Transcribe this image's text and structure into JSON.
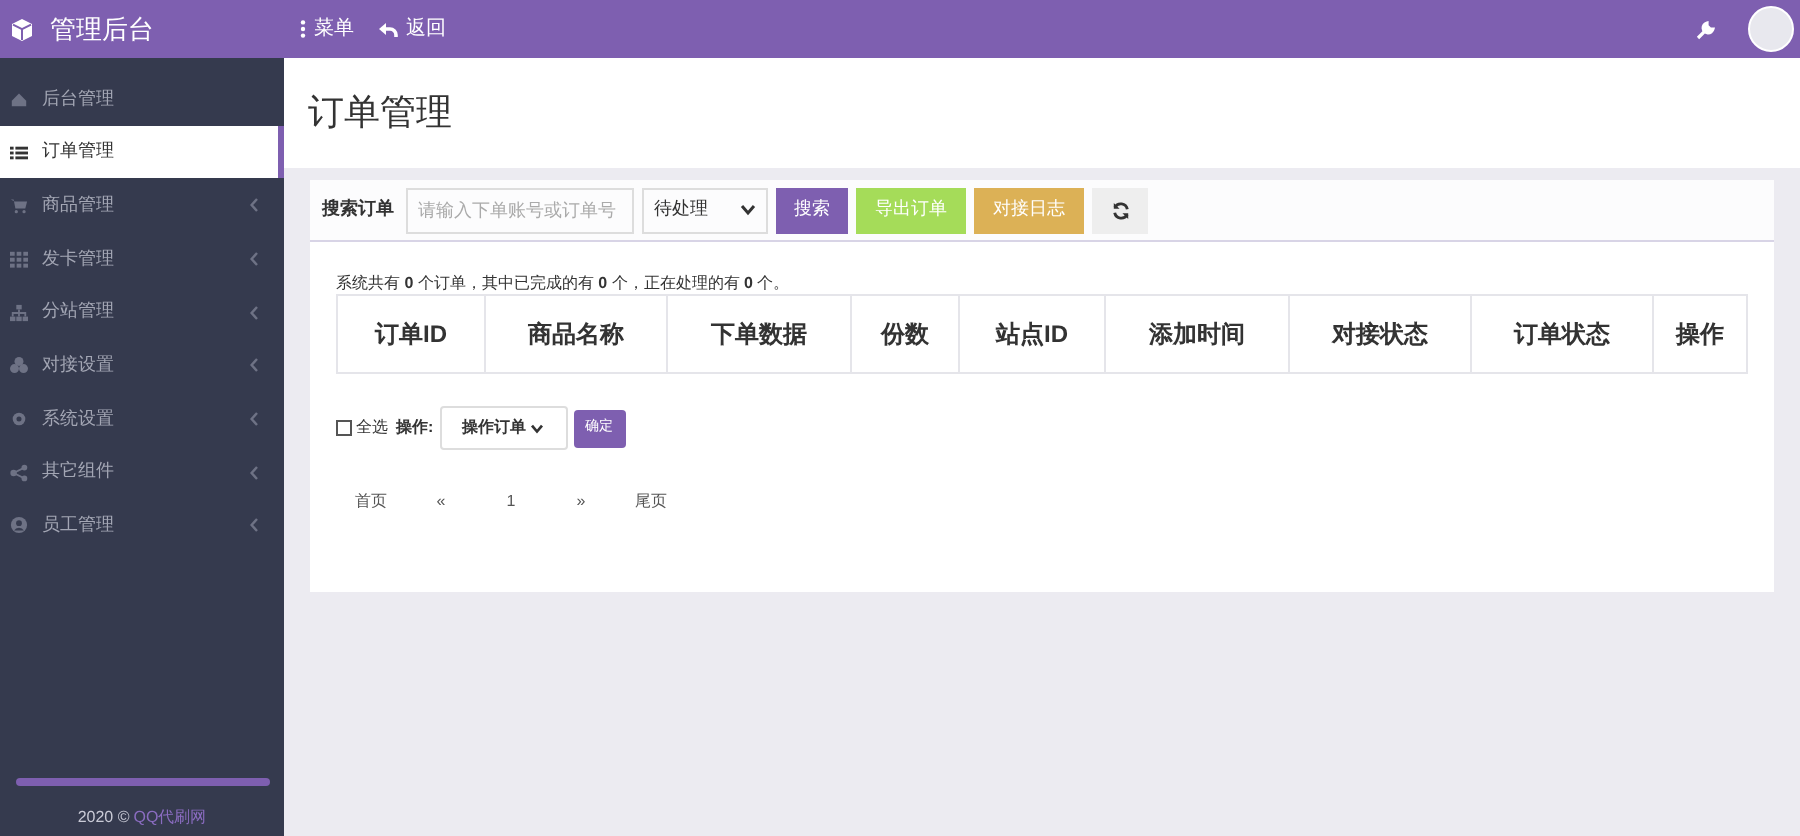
{
  "header": {
    "brand": "管理后台",
    "nav": [
      {
        "kind": "menu",
        "label": "菜单"
      },
      {
        "kind": "back",
        "label": "返回"
      }
    ]
  },
  "sidebar": {
    "items": [
      {
        "label": "后台管理",
        "selected": false,
        "expandable": false
      },
      {
        "label": "订单管理",
        "selected": true,
        "expandable": false
      },
      {
        "label": "商品管理",
        "selected": false,
        "expandable": true
      },
      {
        "label": "发卡管理",
        "selected": false,
        "expandable": true
      },
      {
        "label": "分站管理",
        "selected": false,
        "expandable": true
      },
      {
        "label": "对接设置",
        "selected": false,
        "expandable": true
      },
      {
        "label": "系统设置",
        "selected": false,
        "expandable": true
      },
      {
        "label": "其它组件",
        "selected": false,
        "expandable": true
      },
      {
        "label": "员工管理",
        "selected": false,
        "expandable": true
      }
    ],
    "footer": {
      "year": "2020 ©",
      "link": "QQ代刷网"
    }
  },
  "page_title": "订单管理",
  "toolbar": {
    "label": "搜索订单",
    "placeholder": "请输入下单账号或订单号",
    "status_select": "待处理",
    "buttons": [
      {
        "kind": "search",
        "label": "搜索"
      },
      {
        "kind": "export",
        "label": "导出订单"
      },
      {
        "kind": "log",
        "label": "对接日志"
      },
      {
        "kind": "refresh"
      }
    ]
  },
  "summary": "系统共有 **0** 个订单，其中已完成的有 **0** 个，正在处理的有 **0** 个。",
  "table": {
    "columns": [
      "订单ID",
      "商品名称",
      "下单数据",
      "份数",
      "站点ID",
      "添加时间",
      "对接状态",
      "订单状态",
      "操作"
    ]
  },
  "bulk": {
    "select_all": {
      "label": "全选",
      "checked": false
    },
    "action_label": "操作:",
    "action_select": "操作订单",
    "confirm": "确定"
  },
  "pagination": [
    "首页",
    "«",
    "1",
    "»",
    "尾页"
  ]
}
